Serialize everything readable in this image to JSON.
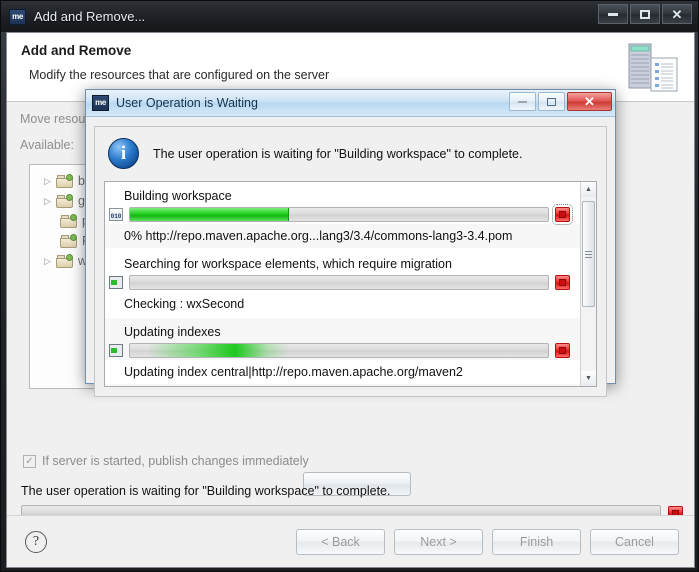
{
  "outer_window": {
    "title": "Add and Remove...",
    "app_icon_text": "me",
    "controls": {
      "minimize": "minimize-icon",
      "maximize": "maximize-icon",
      "close": "close-icon"
    }
  },
  "wizard": {
    "title": "Add and Remove",
    "subtitle": "Modify the resources that are configured on the server",
    "banner_icon": "server-and-list-icon",
    "move_label": "Move resources to the right to configure them on the server",
    "available_label": "Available:",
    "tree_items": [
      {
        "label": "bio",
        "expandable": true
      },
      {
        "label": "gen",
        "expandable": true
      },
      {
        "label": "per",
        "expandable": false
      },
      {
        "label": "Rep",
        "expandable": false
      },
      {
        "label": "wxS",
        "expandable": true
      }
    ],
    "publish_checkbox": {
      "label": "If server is started, publish changes immediately",
      "checked": true,
      "enabled": false,
      "mark": "✓"
    },
    "status_text": "The user operation is waiting for \"Building workspace\" to complete.",
    "status_progress_percent": 0,
    "help_icon": "?",
    "buttons": [
      {
        "label": "< Back",
        "enabled": false
      },
      {
        "label": "Next >",
        "enabled": false
      },
      {
        "label": "Finish",
        "enabled": false
      },
      {
        "label": "Cancel",
        "enabled": false
      }
    ]
  },
  "dialog": {
    "title": "User Operation is Waiting",
    "app_icon_text": "me",
    "message": "The user operation is waiting for \"Building workspace\" to complete.",
    "info_icon": "i",
    "controls": {
      "minimize": "minimize-icon",
      "restore": "restore-icon",
      "close": "close-icon",
      "close_glyph": "✕"
    },
    "tasks": [
      {
        "name": "Building workspace",
        "icon": "binary-file-icon",
        "progress_percent": 38,
        "indeterminate": false,
        "detail": "0% http://repo.maven.apache.org...lang3/3.4/commons-lang3-3.4.pom",
        "stop_button": "stop-icon",
        "focused": true
      },
      {
        "name": "Searching for workspace elements, which require migration",
        "icon": "migration-icon",
        "progress_percent": 0,
        "indeterminate": false,
        "detail": "Checking : wxSecond",
        "stop_button": "stop-icon",
        "focused": false
      },
      {
        "name": "Updating indexes",
        "icon": "migration-icon",
        "progress_percent": 0,
        "indeterminate": true,
        "detail": "Updating index central|http://repo.maven.apache.org/maven2",
        "stop_button": "stop-icon",
        "focused": false
      }
    ],
    "scrollbar": {
      "up": "▲",
      "down": "▼"
    }
  },
  "colors": {
    "progress_green": "#14b814",
    "stop_red": "#d61414",
    "info_blue": "#2f7fd0",
    "dialog_title_blue": "#b9d8f1"
  }
}
